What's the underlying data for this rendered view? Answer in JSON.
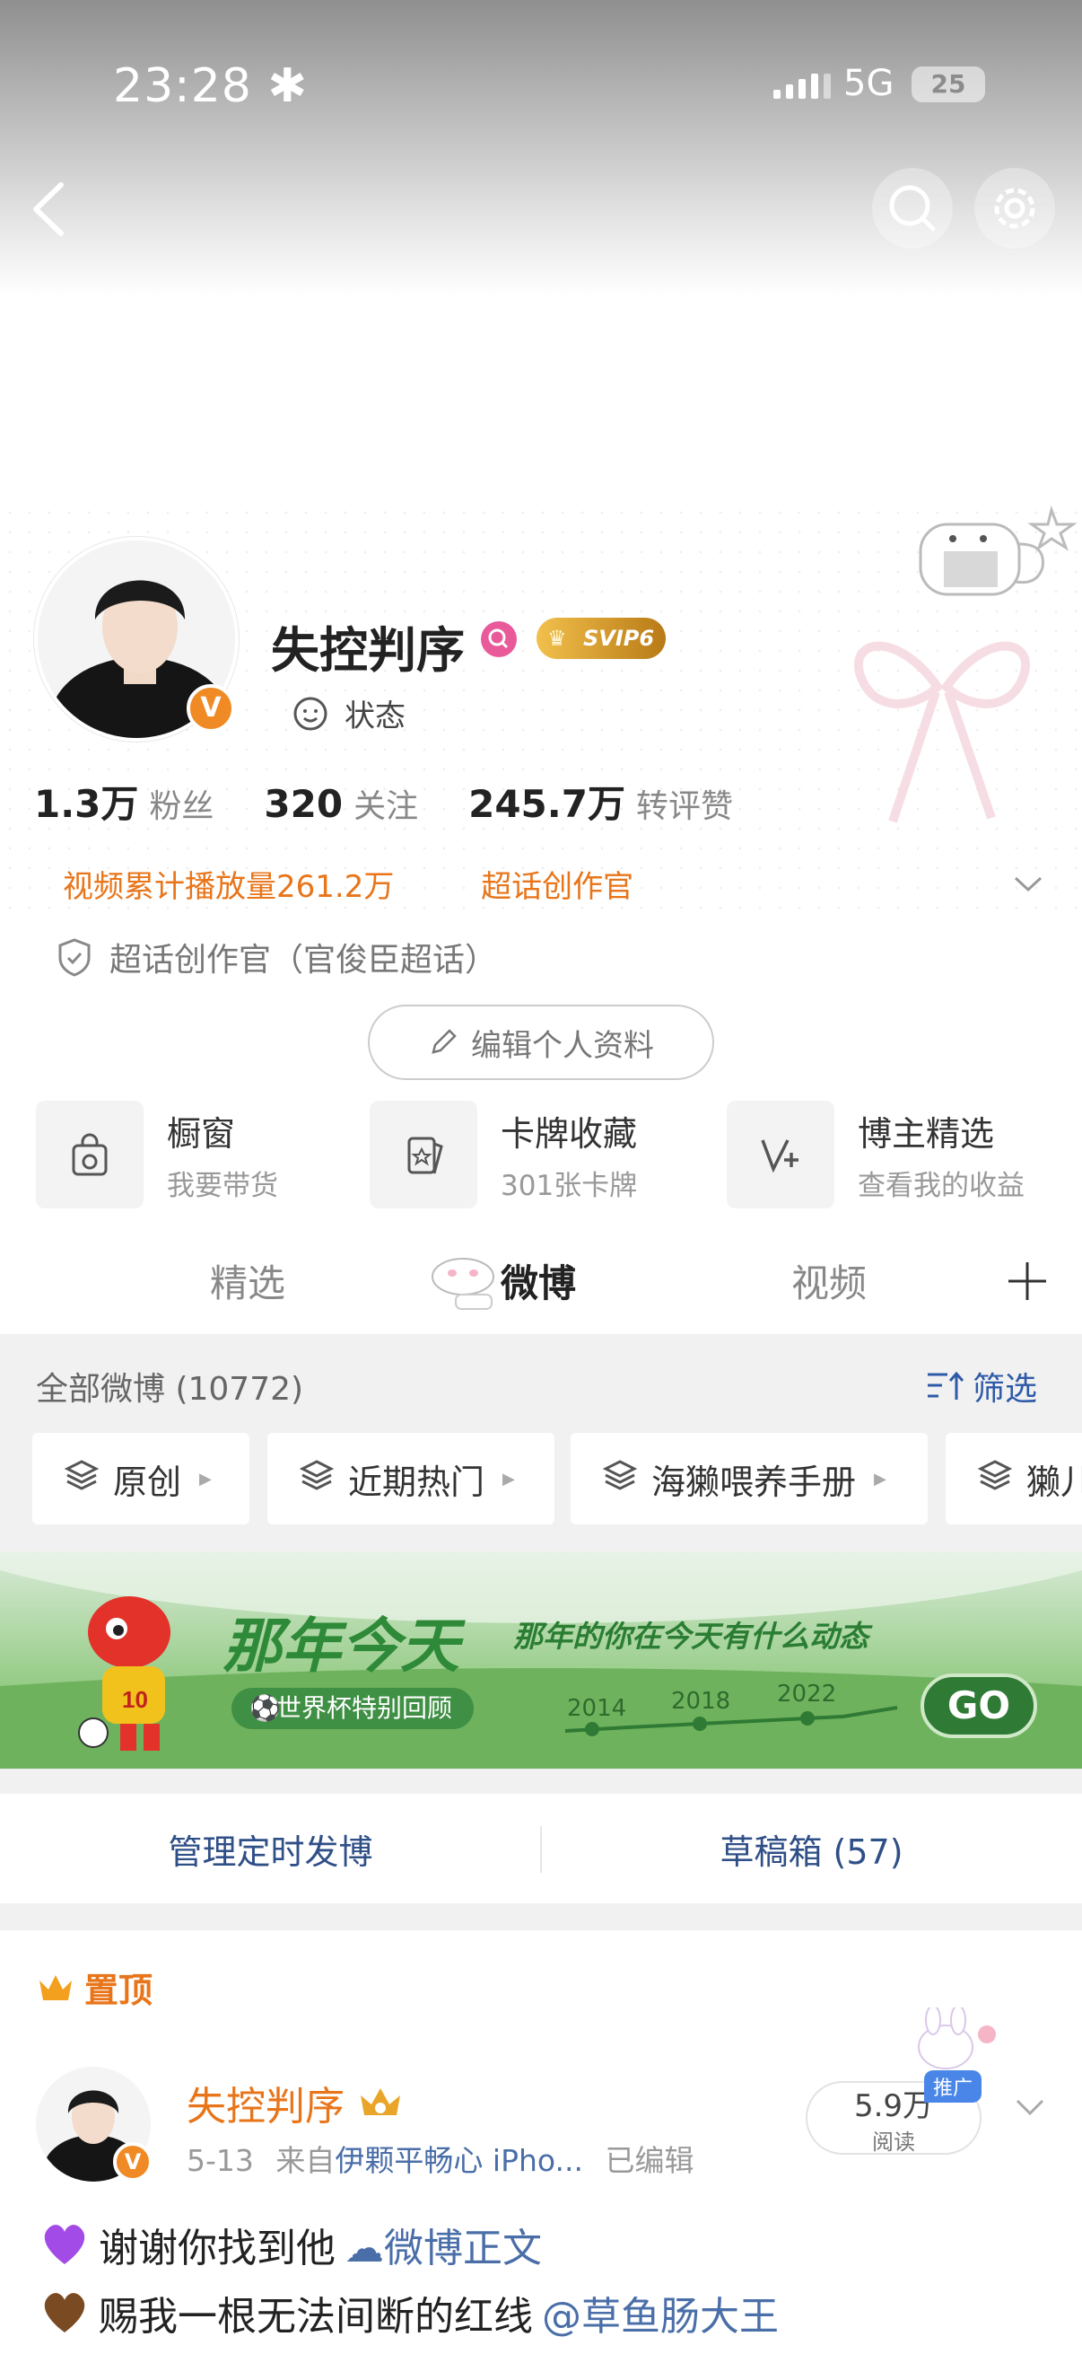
{
  "status_bar": {
    "time": "23:28",
    "network": "5G",
    "battery": "25"
  },
  "profile": {
    "name": "失控判序",
    "vip_badge": "SVIP6",
    "status_label": "状态",
    "stats": [
      {
        "value": "1.3万",
        "label": "粉丝"
      },
      {
        "value": "320",
        "label": "关注"
      },
      {
        "value": "245.7万",
        "label": "转评赞"
      }
    ],
    "highlight_1": "视频累计播放量261.2万",
    "highlight_2": "超话创作官",
    "certification": "超话创作官（官俊臣超话）",
    "edit_button": "编辑个人资料"
  },
  "tools": [
    {
      "title": "橱窗",
      "subtitle": "我要带货",
      "icon": "bag-icon"
    },
    {
      "title": "卡牌收藏",
      "subtitle": "301张卡牌",
      "icon": "card-icon"
    },
    {
      "title": "博主精选",
      "subtitle": "查看我的收益",
      "icon": "v-plus-icon"
    }
  ],
  "tabs": [
    "精选",
    "微博",
    "视频"
  ],
  "active_tab": "微博",
  "feed": {
    "all_label": "全部微博 (10772)",
    "filter_label": "筛选",
    "chips": [
      "原创",
      "近期热门",
      "海獭喂养手册",
      "獭儿"
    ]
  },
  "banner": {
    "title": "那年今天",
    "subtitle": "那年的你在今天有什么动态",
    "pill": "世界杯特别回顾",
    "years": [
      "2014",
      "2018",
      "2022"
    ],
    "go": "GO",
    "jersey_number": "10"
  },
  "schedule": {
    "left": "管理定时发博",
    "right": "草稿箱 (57)"
  },
  "post": {
    "pinned_label": "置顶",
    "author": "失控判序",
    "date": "5-13",
    "source_prefix": "来自",
    "source": "伊颗平畅心 iPho...",
    "edited": "已编辑",
    "reads_value": "5.9万",
    "reads_label": "阅读",
    "promo": "推广",
    "line1_text": "谢谢你找到他",
    "line1_link": "微博正文",
    "line2_text": "赐我一根无法间断的红线",
    "line2_mention": "@草鱼肠大王"
  },
  "colors": {
    "accent_orange": "#e8751a",
    "link_blue": "#4a6ea8",
    "vip_gold": "#d89a2a",
    "pink_magnifier": "#e85a9a"
  }
}
